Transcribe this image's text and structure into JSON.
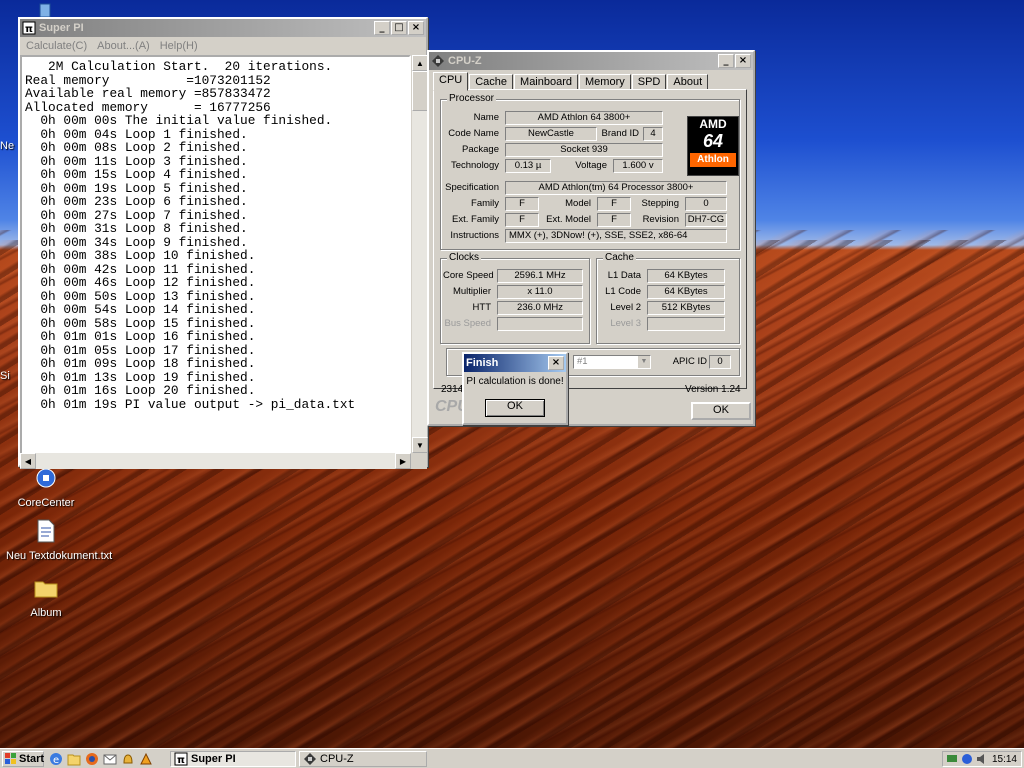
{
  "desktop": {
    "icons": [
      {
        "label": "Ne",
        "icon": "document-icon"
      },
      {
        "label": "Si",
        "icon": "shortcut-icon"
      },
      {
        "label": "CoreCenter",
        "icon": "corecenter-icon"
      },
      {
        "label": "Neu Textdokument.txt",
        "icon": "text-file-icon"
      },
      {
        "label": "Album",
        "icon": "folder-icon"
      }
    ]
  },
  "superpi": {
    "title": "Super PI",
    "menu": [
      "Calculate(C)",
      "About...(A)",
      "Help(H)"
    ],
    "output_lines": [
      "   2M Calculation Start.  20 iterations.",
      "Real memory          =1073201152",
      "Available real memory =857833472",
      "Allocated memory      = 16777256",
      "  0h 00m 00s The initial value finished.",
      "  0h 00m 04s Loop 1 finished.",
      "  0h 00m 08s Loop 2 finished.",
      "  0h 00m 11s Loop 3 finished.",
      "  0h 00m 15s Loop 4 finished.",
      "  0h 00m 19s Loop 5 finished.",
      "  0h 00m 23s Loop 6 finished.",
      "  0h 00m 27s Loop 7 finished.",
      "  0h 00m 31s Loop 8 finished.",
      "  0h 00m 34s Loop 9 finished.",
      "  0h 00m 38s Loop 10 finished.",
      "  0h 00m 42s Loop 11 finished.",
      "  0h 00m 46s Loop 12 finished.",
      "  0h 00m 50s Loop 13 finished.",
      "  0h 00m 54s Loop 14 finished.",
      "  0h 00m 58s Loop 15 finished.",
      "  0h 01m 01s Loop 16 finished.",
      "  0h 01m 05s Loop 17 finished.",
      "  0h 01m 09s Loop 18 finished.",
      "  0h 01m 13s Loop 19 finished.",
      "  0h 01m 16s Loop 20 finished.",
      "  0h 01m 19s PI value output -> pi_data.txt"
    ]
  },
  "cpuz": {
    "title": "CPU-Z",
    "tabs": [
      "CPU",
      "Cache",
      "Mainboard",
      "Memory",
      "SPD",
      "About"
    ],
    "processor": {
      "group_title": "Processor",
      "name_label": "Name",
      "name": "AMD Athlon 64 3800+",
      "codename_label": "Code Name",
      "codename": "NewCastle",
      "brandid_label": "Brand ID",
      "brandid": "4",
      "package_label": "Package",
      "package": "Socket 939",
      "technology_label": "Technology",
      "technology": "0.13 µ",
      "voltage_label": "Voltage",
      "voltage": "1.600 v",
      "spec_label": "Specification",
      "spec": "AMD Athlon(tm) 64 Processor 3800+",
      "family_label": "Family",
      "family": "F",
      "model_label": "Model",
      "model": "F",
      "stepping_label": "Stepping",
      "stepping": "0",
      "extfamily_label": "Ext. Family",
      "extfamily": "F",
      "extmodel_label": "Ext. Model",
      "extmodel": "F",
      "revision_label": "Revision",
      "revision": "DH7-CG",
      "instructions_label": "Instructions",
      "instructions": "MMX (+), 3DNow! (+), SSE, SSE2, x86-64",
      "logo_top": "AMD",
      "logo_mid": "64",
      "logo_bottom": "Athlon"
    },
    "clocks": {
      "group_title": "Clocks",
      "corespeed_label": "Core Speed",
      "corespeed": "2596.1 MHz",
      "multiplier_label": "Multiplier",
      "multiplier": "x 11.0",
      "htt_label": "HTT",
      "htt": "236.0 MHz",
      "busspeed_label": "Bus Speed",
      "busspeed": ""
    },
    "cache": {
      "group_title": "Cache",
      "l1data_label": "L1 Data",
      "l1data": "64 KBytes",
      "l1code_label": "L1 Code",
      "l1code": "64 KBytes",
      "level2_label": "Level 2",
      "level2": "512 KBytes",
      "level3_label": "Level 3",
      "level3": ""
    },
    "selection": "#1",
    "apicid_label": "APIC ID",
    "apicid": "0",
    "footer_left": "2314",
    "version": "Version 1.24",
    "ok_label": "OK",
    "watermark": "CPU"
  },
  "finish_dialog": {
    "title": "Finish",
    "message": "PI calculation is done!",
    "ok_label": "OK"
  },
  "taskbar": {
    "start_label": "Start",
    "items": [
      "Super PI",
      "CPU-Z"
    ],
    "clock": "15:14"
  },
  "colors": {
    "titlebar_active": "#0a246a",
    "amd_orange": "#ff6600",
    "window_face": "#d4d0c8"
  }
}
